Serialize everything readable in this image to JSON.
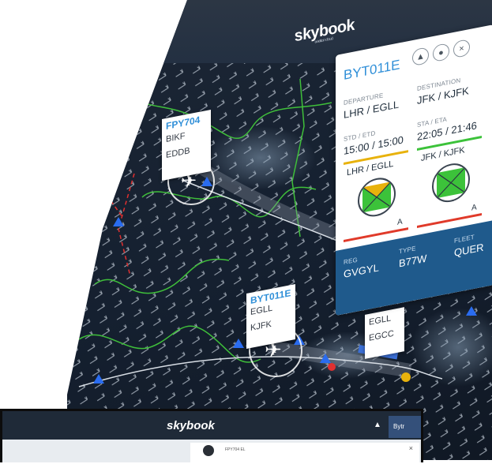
{
  "app": {
    "name": "skybook",
    "tagline": "aviation cloud"
  },
  "flight_card": {
    "callsign": "BYT011E",
    "icons": [
      "alert-triangle-icon",
      "location-pin-icon",
      "close-icon"
    ],
    "departure_label": "DEPARTURE",
    "departure_value": "LHR / EGLL",
    "destination_label": "DESTINATION",
    "destination_value": "JFK / KJFK",
    "std_label": "STD / ETD",
    "std_value": "15:00 / 15:00",
    "sta_label": "STA / ETA",
    "sta_value": "22:05 / 21:46",
    "dep_airport": "LHR / EGLL",
    "arr_airport": "JFK / KJFK",
    "dep_grade": "A",
    "arr_grade": "A",
    "reg_label": "REG",
    "reg_value": "GVGYL",
    "type_label": "TYPE",
    "type_value": "B77W",
    "fleet_label": "FLEET",
    "fleet_value": "QUER",
    "colors": {
      "dep_bar": "#e8b20c",
      "arr_bar": "#3cc23a",
      "grade_bar": "#e03a2a",
      "accent": "#2f8fd8"
    }
  },
  "map_labels": [
    {
      "callsign": "FPY704",
      "origin": "BIKF",
      "dest": "EDDB"
    },
    {
      "callsign": "BYT011E",
      "origin": "EGLL",
      "dest": "KJFK"
    },
    {
      "callsign": "",
      "origin": "EGLL",
      "dest": "EGCC"
    }
  ],
  "second_screen": {
    "app_name": "skybook",
    "user_label": "Bytr",
    "close_symbol": "×",
    "panel_text": "FPY704 EL"
  }
}
